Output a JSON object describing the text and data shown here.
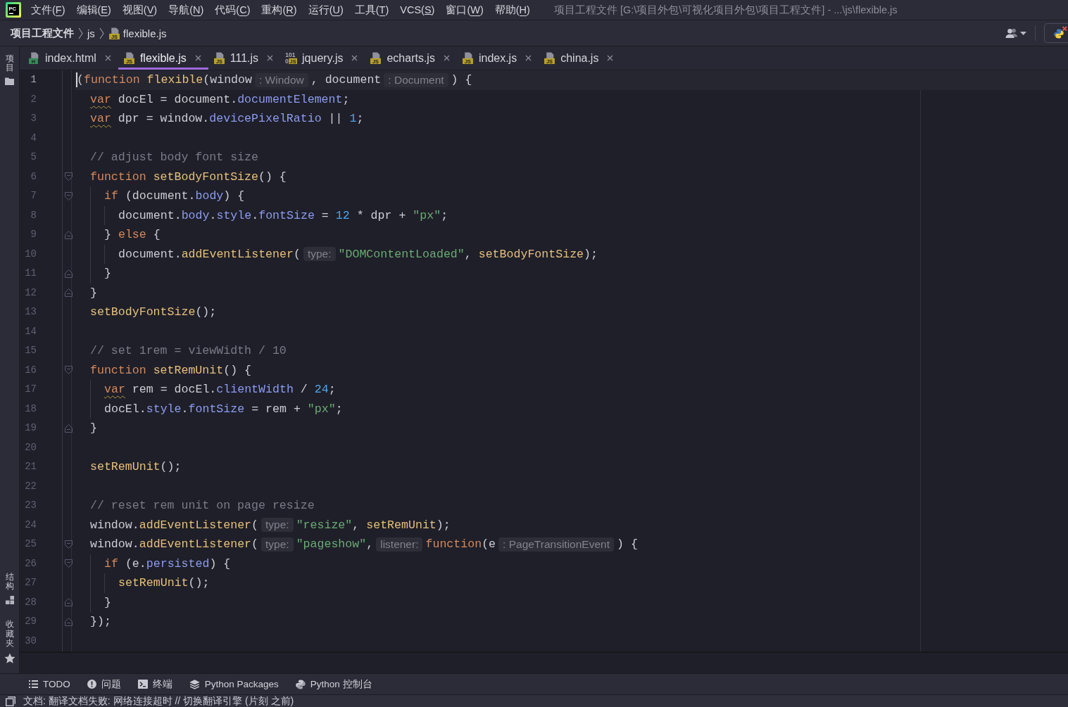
{
  "menu_bar": {
    "logo": "PC",
    "items": [
      "文件(F)",
      "编辑(E)",
      "视图(V)",
      "导航(N)",
      "代码(C)",
      "重构(R)",
      "运行(U)",
      "工具(T)",
      "VCS(S)",
      "窗口(W)",
      "帮助(H)"
    ],
    "title": "项目工程文件 [G:\\项目外包\\可视化项目外包\\项目工程文件] - ...\\js\\flexible.js"
  },
  "breadcrumbs": [
    {
      "kind": "project",
      "label": "项目工程文件"
    },
    {
      "kind": "folder",
      "label": "js"
    },
    {
      "kind": "file",
      "label": "flexible.js",
      "badge": "JS"
    }
  ],
  "side_strip": {
    "top": [
      {
        "kind": "project",
        "label": "项目"
      }
    ],
    "bottom": [
      {
        "kind": "structure",
        "label": "结构"
      },
      {
        "kind": "favorites",
        "label": "收藏夹"
      }
    ]
  },
  "tabs": [
    {
      "label": "index.html",
      "kind": "html",
      "badge": "H",
      "selected": false
    },
    {
      "label": "flexible.js",
      "kind": "js",
      "badge": "JS",
      "selected": true
    },
    {
      "label": "111.js",
      "kind": "js",
      "badge": "JS",
      "selected": false
    },
    {
      "label": "jquery.js",
      "kind": "minified",
      "badge": "JS",
      "digits": [
        "101",
        "0"
      ],
      "selected": false
    },
    {
      "label": "echarts.js",
      "kind": "js",
      "badge": "JS",
      "selected": false
    },
    {
      "label": "index.js",
      "kind": "js",
      "badge": "JS",
      "selected": false
    },
    {
      "label": "china.js",
      "kind": "js",
      "badge": "JS",
      "selected": false
    }
  ],
  "editor": {
    "lines": [
      {
        "number": "1",
        "current": true,
        "tokens": [
          {
            "kind": "plain",
            "text": "("
          },
          {
            "kind": "keyword",
            "text": "function "
          },
          {
            "kind": "function",
            "text": "flexible"
          },
          {
            "kind": "plain",
            "text": "(window"
          },
          {
            "kind": "hint",
            "text": ": Window"
          },
          {
            "kind": "plain",
            "text": ", document"
          },
          {
            "kind": "hint",
            "text": ": Document"
          },
          {
            "kind": "plain",
            "text": ") {"
          }
        ],
        "children": [
          {
            "number": "2",
            "current": false,
            "tokens": [
              {
                "kind": "keyword_warn",
                "text": "var"
              },
              {
                "kind": "plain",
                "text": " docEl = document."
              },
              {
                "kind": "property",
                "text": "documentElement"
              },
              {
                "kind": "plain",
                "text": ";"
              }
            ]
          },
          {
            "number": "3",
            "current": false,
            "tokens": [
              {
                "kind": "keyword_warn",
                "text": "var"
              },
              {
                "kind": "plain",
                "text": " dpr = window."
              },
              {
                "kind": "property",
                "text": "devicePixelRatio"
              },
              {
                "kind": "plain",
                "text": " || "
              },
              {
                "kind": "number",
                "text": "1"
              },
              {
                "kind": "plain",
                "text": ";"
              }
            ]
          },
          {
            "number": "4",
            "current": false
          },
          {
            "number": "5",
            "current": false,
            "tokens": [
              {
                "kind": "comment",
                "text": "// adjust body font size"
              }
            ]
          },
          {
            "number": "6",
            "kind": "fold_start",
            "current": false,
            "tokens": [
              {
                "kind": "keyword",
                "text": "function "
              },
              {
                "kind": "function",
                "text": "setBodyFontSize"
              },
              {
                "kind": "plain",
                "text": "() {"
              }
            ],
            "children": [
              {
                "number": "7",
                "kind": "fold_start",
                "current": false,
                "tokens": [
                  {
                    "kind": "keyword",
                    "text": "if"
                  },
                  {
                    "kind": "plain",
                    "text": " (document."
                  },
                  {
                    "kind": "property",
                    "text": "body"
                  },
                  {
                    "kind": "plain",
                    "text": ") {"
                  }
                ],
                "children": [
                  {
                    "number": "8",
                    "current": false,
                    "tokens": [
                      {
                        "kind": "plain",
                        "text": "document."
                      },
                      {
                        "kind": "property",
                        "text": "body"
                      },
                      {
                        "kind": "plain",
                        "text": "."
                      },
                      {
                        "kind": "property",
                        "text": "style"
                      },
                      {
                        "kind": "plain",
                        "text": "."
                      },
                      {
                        "kind": "property",
                        "text": "fontSize"
                      },
                      {
                        "kind": "plain",
                        "text": " = "
                      },
                      {
                        "kind": "number",
                        "text": "12"
                      },
                      {
                        "kind": "plain",
                        "text": " * dpr + "
                      },
                      {
                        "kind": "string",
                        "text": "\"px\""
                      },
                      {
                        "kind": "plain",
                        "text": ";"
                      }
                    ]
                  }
                ]
              },
              {
                "number": "9",
                "kind": "fold_end",
                "current": false,
                "tokens": [
                  {
                    "kind": "plain",
                    "text": "} "
                  },
                  {
                    "kind": "keyword",
                    "text": "else"
                  },
                  {
                    "kind": "plain",
                    "text": " {"
                  }
                ],
                "children": [
                  {
                    "number": "10",
                    "current": false,
                    "tokens": [
                      {
                        "kind": "plain",
                        "text": "document."
                      },
                      {
                        "kind": "function",
                        "text": "addEventListener"
                      },
                      {
                        "kind": "plain",
                        "text": "("
                      },
                      {
                        "kind": "hint",
                        "text": "type:"
                      },
                      {
                        "kind": "string",
                        "text": "\"DOMContentLoaded\""
                      },
                      {
                        "kind": "plain",
                        "text": ", "
                      },
                      {
                        "kind": "function",
                        "text": "setBodyFontSize"
                      },
                      {
                        "kind": "plain",
                        "text": ");"
                      }
                    ]
                  }
                ]
              },
              {
                "number": "11",
                "kind": "fold_end",
                "current": false,
                "tokens": [
                  {
                    "kind": "plain",
                    "text": "}"
                  }
                ]
              }
            ]
          },
          {
            "number": "12",
            "kind": "fold_end",
            "current": false,
            "tokens": [
              {
                "kind": "plain",
                "text": "}"
              }
            ]
          },
          {
            "number": "13",
            "current": false,
            "tokens": [
              {
                "kind": "function",
                "text": "setBodyFontSize"
              },
              {
                "kind": "plain",
                "text": "();"
              }
            ]
          },
          {
            "number": "14",
            "current": false
          },
          {
            "number": "15",
            "current": false,
            "tokens": [
              {
                "kind": "comment",
                "text": "// set 1rem = viewWidth / 10"
              }
            ]
          },
          {
            "number": "16",
            "kind": "fold_start",
            "current": false,
            "tokens": [
              {
                "kind": "keyword",
                "text": "function "
              },
              {
                "kind": "function",
                "text": "setRemUnit"
              },
              {
                "kind": "plain",
                "text": "() {"
              }
            ],
            "children": [
              {
                "number": "17",
                "current": false,
                "tokens": [
                  {
                    "kind": "keyword_warn",
                    "text": "var"
                  },
                  {
                    "kind": "plain",
                    "text": " rem = docEl."
                  },
                  {
                    "kind": "property",
                    "text": "clientWidth"
                  },
                  {
                    "kind": "plain",
                    "text": " / "
                  },
                  {
                    "kind": "number",
                    "text": "24"
                  },
                  {
                    "kind": "plain",
                    "text": ";"
                  }
                ]
              },
              {
                "number": "18",
                "current": false,
                "tokens": [
                  {
                    "kind": "plain",
                    "text": "docEl."
                  },
                  {
                    "kind": "property",
                    "text": "style"
                  },
                  {
                    "kind": "plain",
                    "text": "."
                  },
                  {
                    "kind": "property",
                    "text": "fontSize"
                  },
                  {
                    "kind": "plain",
                    "text": " = rem + "
                  },
                  {
                    "kind": "string",
                    "text": "\"px\""
                  },
                  {
                    "kind": "plain",
                    "text": ";"
                  }
                ]
              }
            ]
          },
          {
            "number": "19",
            "kind": "fold_end",
            "current": false,
            "tokens": [
              {
                "kind": "plain",
                "text": "}"
              }
            ]
          },
          {
            "number": "20",
            "current": false
          },
          {
            "number": "21",
            "current": false,
            "tokens": [
              {
                "kind": "function",
                "text": "setRemUnit"
              },
              {
                "kind": "plain",
                "text": "();"
              }
            ]
          },
          {
            "number": "22",
            "current": false
          },
          {
            "number": "23",
            "current": false,
            "tokens": [
              {
                "kind": "comment",
                "text": "// reset rem unit on page resize"
              }
            ]
          },
          {
            "number": "24",
            "current": false,
            "tokens": [
              {
                "kind": "plain",
                "text": "window."
              },
              {
                "kind": "function",
                "text": "addEventListener"
              },
              {
                "kind": "plain",
                "text": "("
              },
              {
                "kind": "hint",
                "text": "type:"
              },
              {
                "kind": "string",
                "text": "\"resize\""
              },
              {
                "kind": "plain",
                "text": ", "
              },
              {
                "kind": "function",
                "text": "setRemUnit"
              },
              {
                "kind": "plain",
                "text": ");"
              }
            ]
          },
          {
            "number": "25",
            "kind": "fold_start",
            "current": false,
            "tokens": [
              {
                "kind": "plain",
                "text": "window."
              },
              {
                "kind": "function",
                "text": "addEventListener"
              },
              {
                "kind": "plain",
                "text": "("
              },
              {
                "kind": "hint",
                "text": "type:"
              },
              {
                "kind": "string",
                "text": "\"pageshow\""
              },
              {
                "kind": "plain",
                "text": ","
              },
              {
                "kind": "hint",
                "text": "listener:"
              },
              {
                "kind": "keyword",
                "text": "function"
              },
              {
                "kind": "plain",
                "text": "(e"
              },
              {
                "kind": "hint",
                "text": ": PageTransitionEvent"
              },
              {
                "kind": "plain",
                "text": ") {"
              }
            ],
            "children": [
              {
                "number": "26",
                "kind": "fold_start",
                "current": false,
                "tokens": [
                  {
                    "kind": "keyword",
                    "text": "if"
                  },
                  {
                    "kind": "plain",
                    "text": " (e."
                  },
                  {
                    "kind": "property",
                    "text": "persisted"
                  },
                  {
                    "kind": "plain",
                    "text": ") {"
                  }
                ],
                "children": [
                  {
                    "number": "27",
                    "current": false,
                    "tokens": [
                      {
                        "kind": "function",
                        "text": "setRemUnit"
                      },
                      {
                        "kind": "plain",
                        "text": "();"
                      }
                    ]
                  }
                ]
              },
              {
                "number": "28",
                "kind": "fold_end",
                "current": false,
                "tokens": [
                  {
                    "kind": "plain",
                    "text": "}"
                  }
                ]
              }
            ]
          },
          {
            "number": "29",
            "kind": "fold_end",
            "current": false,
            "tokens": [
              {
                "kind": "plain",
                "text": "});"
              }
            ]
          }
        ]
      },
      {
        "number": "30",
        "current": false
      }
    ]
  },
  "tool_windows": [
    {
      "kind": "todo",
      "label": "TODO"
    },
    {
      "kind": "problems",
      "label": "问题"
    },
    {
      "kind": "terminal",
      "label": "终端"
    },
    {
      "kind": "packages",
      "label": "Python Packages"
    },
    {
      "kind": "console",
      "label": "Python 控制台"
    }
  ],
  "status_bar": {
    "message": "文档: 翻译文档失败: 网络连接超时 // 切换翻译引擎 (片刻 之前)"
  }
}
